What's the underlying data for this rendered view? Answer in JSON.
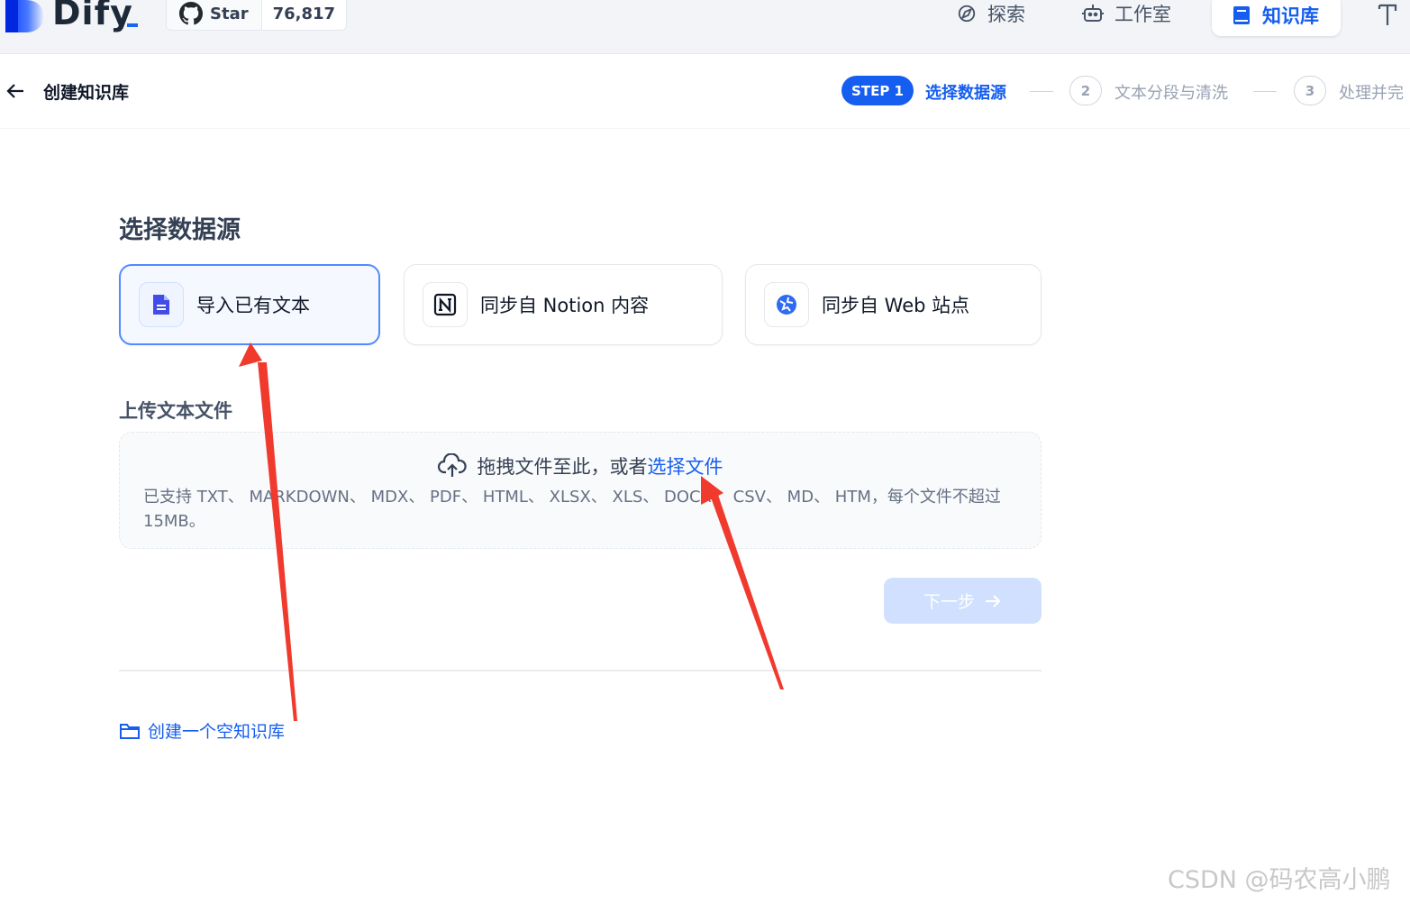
{
  "topbar": {
    "logo_text": "Dify",
    "github": {
      "star_label": "Star",
      "star_count": "76,817"
    },
    "nav": [
      {
        "label": "探索",
        "icon": "compass-icon"
      },
      {
        "label": "工作室",
        "icon": "robot-icon"
      },
      {
        "label": "知识库",
        "icon": "book-icon",
        "active": true
      }
    ],
    "extra_icon": "tool-icon"
  },
  "header": {
    "title": "创建知识库",
    "steps": [
      {
        "badge": "STEP 1",
        "label": "选择数据源",
        "active": true
      },
      {
        "badge": "2",
        "label": "文本分段与清洗"
      },
      {
        "badge": "3",
        "label": "处理并完"
      }
    ]
  },
  "main": {
    "section_title": "选择数据源",
    "sources": [
      {
        "label": "导入已有文本",
        "icon": "file-text-icon",
        "selected": true
      },
      {
        "label": "同步自 Notion 内容",
        "icon": "notion-icon"
      },
      {
        "label": "同步自 Web 站点",
        "icon": "web-icon"
      }
    ],
    "upload_title": "上传文本文件",
    "dropzone": {
      "prompt": "拖拽文件至此，或者 ",
      "link": "选择文件",
      "support": "已支持 TXT、 MARKDOWN、 MDX、 PDF、 HTML、 XLSX、 XLS、 DOCX、 CSV、 MD、 HTM，每个文件不超过 15MB。"
    },
    "next_button": "下一步",
    "empty_link": "创建一个空知识库"
  },
  "watermark": "CSDN @码农高小鹏",
  "colors": {
    "accent": "#155eef",
    "annotation_arrow": "#f03a2e"
  }
}
